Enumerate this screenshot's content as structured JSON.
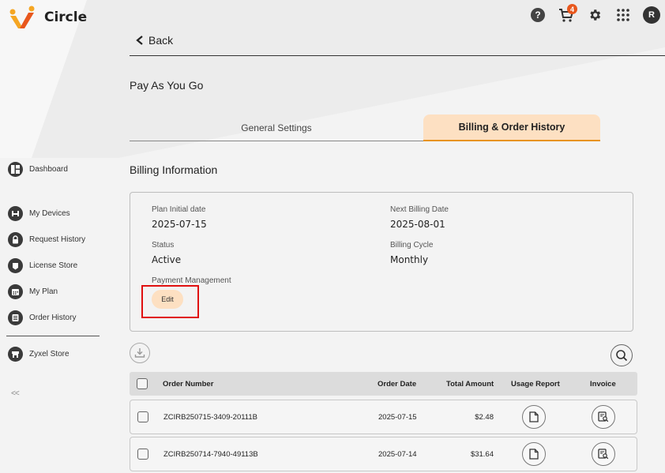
{
  "app": {
    "name": "Circle"
  },
  "topbar": {
    "cart_count": "4",
    "avatar_initial": "R",
    "help_glyph": "?"
  },
  "sidebar": {
    "items": [
      {
        "label": "Dashboard",
        "icon": "dashboard-icon"
      },
      {
        "label": "My Devices",
        "icon": "devices-icon"
      },
      {
        "label": "Request History",
        "icon": "lock-icon"
      },
      {
        "label": "License Store",
        "icon": "license-icon"
      },
      {
        "label": "My Plan",
        "icon": "calendar-icon"
      },
      {
        "label": "Order History",
        "icon": "list-icon"
      },
      {
        "label": "Zyxel Store",
        "icon": "store-icon"
      }
    ],
    "collapse_label": "<<"
  },
  "nav": {
    "back_label": "Back"
  },
  "page": {
    "title": "Pay As You Go"
  },
  "tabs": [
    {
      "label": "General Settings",
      "active": false
    },
    {
      "label": "Billing & Order History",
      "active": true
    }
  ],
  "billing": {
    "section_title": "Billing Information",
    "plan_initial_date_label": "Plan Initial date",
    "plan_initial_date": "2025-07-15",
    "next_billing_date_label": "Next Billing Date",
    "next_billing_date": "2025-08-01",
    "status_label": "Status",
    "status": "Active",
    "billing_cycle_label": "Billing Cycle",
    "billing_cycle": "Monthly",
    "payment_management_label": "Payment Management",
    "edit_label": "Edit"
  },
  "table": {
    "headers": {
      "order_number": "Order Number",
      "order_date": "Order Date",
      "total_amount": "Total Amount",
      "usage_report": "Usage Report",
      "invoice": "Invoice"
    },
    "rows": [
      {
        "order_number": "ZCIRB250715-3409-20111B",
        "order_date": "2025-07-15",
        "total_amount": "$2.48"
      },
      {
        "order_number": "ZCIRB250714-7940-49113B",
        "order_date": "2025-07-14",
        "total_amount": "$31.64"
      }
    ]
  },
  "colors": {
    "accent": "#e8931f",
    "accent_light": "#fde0c2",
    "badge": "#e8571d",
    "highlight": "#e01010"
  }
}
